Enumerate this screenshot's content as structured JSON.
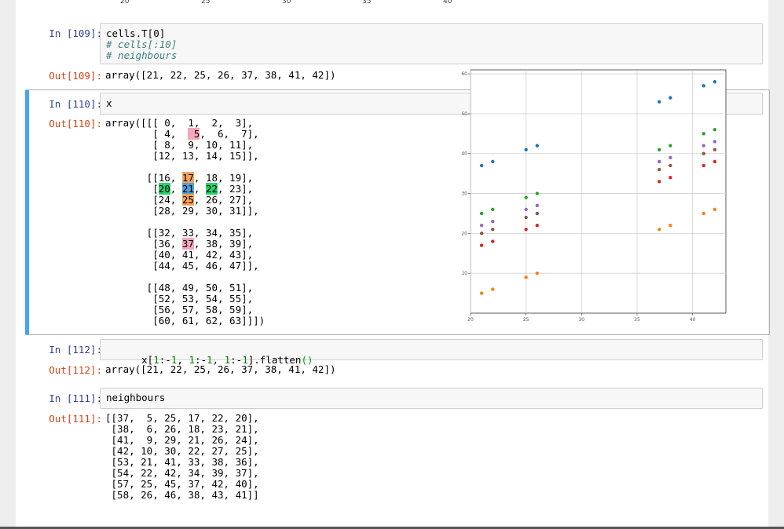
{
  "top_axis_ticks": [
    "20",
    "25",
    "30",
    "35",
    "40"
  ],
  "cells": {
    "in109": {
      "prompt": "In [109]:",
      "line1": "cells.T[0]",
      "line2": "# cells[:10]",
      "line3": "# neighbours"
    },
    "out109": {
      "prompt": "Out[109]:",
      "text": "array([21, 22, 25, 26, 37, 38, 41, 42])"
    },
    "in110": {
      "prompt": "In [110]:",
      "code": "x"
    },
    "out110": {
      "prompt": "Out[110]:"
    },
    "in112": {
      "prompt": "In [112]:",
      "code_parts": [
        "x[",
        "1",
        ":-",
        "1",
        ", ",
        "1",
        ":-",
        "1",
        ", ",
        "1",
        ":-",
        "1",
        "].flatten",
        "()"
      ]
    },
    "out112": {
      "prompt": "Out[112]:",
      "text": "array([21, 22, 25, 26, 37, 38, 41, 42])"
    },
    "in111": {
      "prompt": "In [111]:",
      "code": "neighbours"
    },
    "out111": {
      "prompt": "Out[111]:",
      "lines": [
        "[[37,  5, 25, 17, 22, 20],",
        " [38,  6, 26, 18, 23, 21],",
        " [41,  9, 29, 21, 26, 24],",
        " [42, 10, 30, 22, 27, 25],",
        " [53, 21, 41, 33, 38, 36],",
        " [54, 22, 42, 34, 39, 37],",
        " [57, 25, 45, 37, 42, 40],",
        " [58, 26, 46, 38, 43, 41]]"
      ]
    }
  },
  "array_output": {
    "lines": [
      [
        {
          "t": "array([[[ 0,  1,  2,  3],"
        }
      ],
      [
        {
          "t": "        [ 4,  "
        },
        {
          "t": " 5",
          "h": "pink"
        },
        {
          "t": ",  6,  7],"
        }
      ],
      [
        {
          "t": "        [ 8,  9, 10, 11],"
        }
      ],
      [
        {
          "t": "        [12, 13, 14, 15]],"
        }
      ],
      [
        {
          "t": ""
        }
      ],
      [
        {
          "t": "       [[16, "
        },
        {
          "t": "17",
          "h": "orange"
        },
        {
          "t": ", 18, 19],"
        }
      ],
      [
        {
          "t": "        ["
        },
        {
          "t": "20",
          "h": "green"
        },
        {
          "t": ", "
        },
        {
          "t": "21",
          "h": "blue"
        },
        {
          "t": ", "
        },
        {
          "t": "22",
          "h": "green"
        },
        {
          "t": ", 23],"
        }
      ],
      [
        {
          "t": "        [24, "
        },
        {
          "t": "25",
          "h": "orange"
        },
        {
          "t": ", 26, 27],"
        }
      ],
      [
        {
          "t": "        [28, 29, 30, 31]],"
        }
      ],
      [
        {
          "t": ""
        }
      ],
      [
        {
          "t": "       [[32, 33, 34, 35],"
        }
      ],
      [
        {
          "t": "        [36, "
        },
        {
          "t": "37",
          "h": "pink"
        },
        {
          "t": ", 38, 39],"
        }
      ],
      [
        {
          "t": "        [40, 41, 42, 43],"
        }
      ],
      [
        {
          "t": "        [44, 45, 46, 47]],"
        }
      ],
      [
        {
          "t": ""
        }
      ],
      [
        {
          "t": "       [[48, 49, 50, 51],"
        }
      ],
      [
        {
          "t": "        [52, 53, 54, 55],"
        }
      ],
      [
        {
          "t": "        [56, 57, 58, 59],"
        }
      ],
      [
        {
          "t": "        [60, 61, 62, 63]]])"
        }
      ]
    ]
  },
  "chart_data": {
    "type": "scatter",
    "xlim": [
      20,
      43
    ],
    "ylim": [
      0,
      61
    ],
    "x_ticks": [
      20,
      25,
      30,
      35,
      40
    ],
    "y_ticks": [
      10,
      20,
      30,
      40,
      50,
      60
    ],
    "grid": true,
    "x": [
      21,
      22,
      25,
      26,
      37,
      38,
      41,
      42
    ],
    "series": [
      {
        "color": "#1f77b4",
        "values": [
          37,
          38,
          41,
          42,
          53,
          54,
          57,
          58
        ]
      },
      {
        "color": "#ff7f0e",
        "values": [
          5,
          6,
          9,
          10,
          21,
          22,
          25,
          26
        ]
      },
      {
        "color": "#2ca02c",
        "values": [
          25,
          26,
          29,
          30,
          41,
          42,
          45,
          46
        ]
      },
      {
        "color": "#d62728",
        "values": [
          17,
          18,
          21,
          22,
          33,
          34,
          37,
          38
        ]
      },
      {
        "color": "#9467bd",
        "values": [
          22,
          23,
          26,
          27,
          38,
          39,
          42,
          43
        ]
      },
      {
        "color": "#8c564b",
        "values": [
          20,
          21,
          24,
          25,
          36,
          37,
          40,
          41
        ]
      }
    ]
  }
}
